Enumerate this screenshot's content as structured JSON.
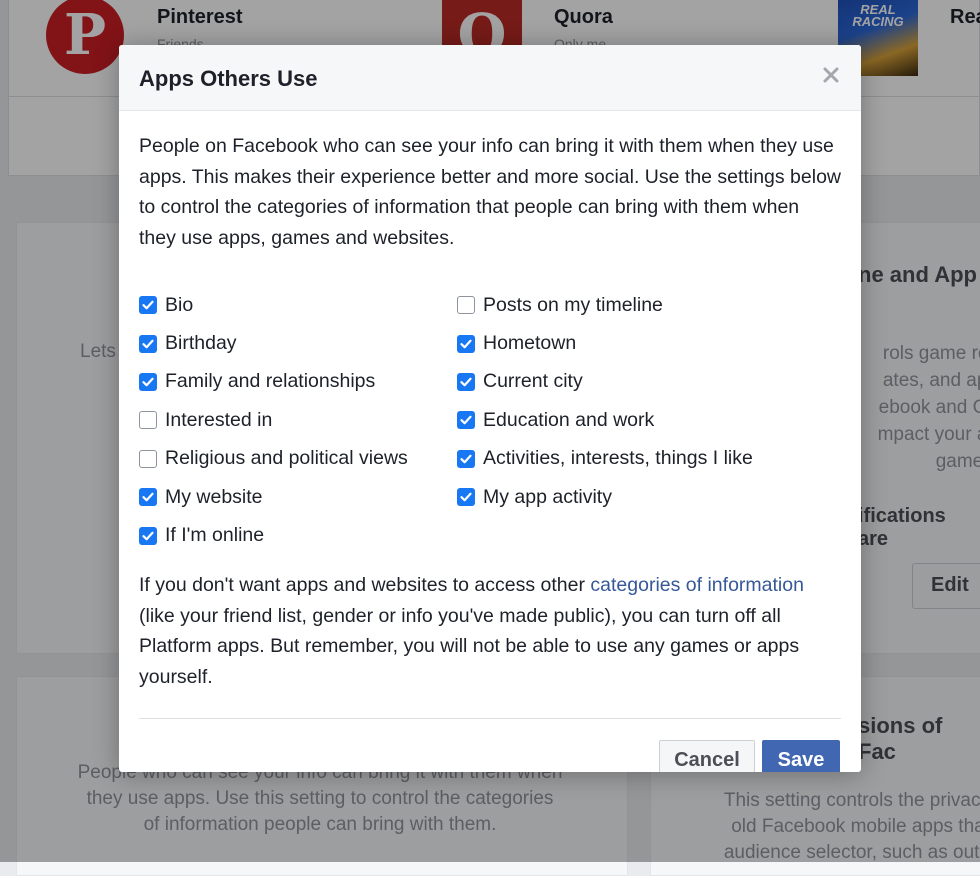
{
  "background": {
    "apps": [
      {
        "name": "Pinterest",
        "visibility": "Friends",
        "logo": "pinterest-logo"
      },
      {
        "name": "Quora",
        "visibility": "Only me",
        "logo": "quora-logo"
      },
      {
        "name": "Rea",
        "logo": "real-racing-logo"
      }
    ],
    "panels": {
      "left_mid_text": "Lets",
      "right_mid_title": "ne and App",
      "right_mid_lines": [
        "rols game rec",
        "ates, and app",
        "ebook and Ga",
        "mpact your ab",
        "games."
      ],
      "right_mid_notif": "ifications are",
      "edit_label": "Edit",
      "bottom_left_lines": [
        "People who can see your info can bring it with them when",
        "they use apps. Use this setting to control the categories",
        "of information people can bring with them."
      ],
      "bottom_right_title": "sions of Fac",
      "bottom_right_lines": [
        "This setting controls the privacy",
        "old Facebook mobile apps that",
        "audience selector, such as outd"
      ]
    }
  },
  "dialog": {
    "title": "Apps Others Use",
    "intro": "People on Facebook who can see your info can bring it with them when they use apps. This makes their experience better and more social. Use the settings below to control the categories of information that people can bring with them when they use apps, games and websites.",
    "left_options": [
      {
        "label": "Bio",
        "checked": true
      },
      {
        "label": "Birthday",
        "checked": true
      },
      {
        "label": "Family and relationships",
        "checked": true
      },
      {
        "label": "Interested in",
        "checked": false
      },
      {
        "label": "Religious and political views",
        "checked": false
      },
      {
        "label": "My website",
        "checked": true
      },
      {
        "label": "If I'm online",
        "checked": true
      }
    ],
    "right_options": [
      {
        "label": "Posts on my timeline",
        "checked": false
      },
      {
        "label": "Hometown",
        "checked": true
      },
      {
        "label": "Current city",
        "checked": true
      },
      {
        "label": "Education and work",
        "checked": true
      },
      {
        "label": "Activities, interests, things I like",
        "checked": true
      },
      {
        "label": "My app activity",
        "checked": true
      }
    ],
    "footer_before_link": "If you don't want apps and websites to access other ",
    "footer_link": "categories of information",
    "footer_after_link": " (like your friend list, gender or info you've made public), you can turn off all Platform apps. But remember, you will not be able to use any games or apps yourself.",
    "cancel_label": "Cancel",
    "save_label": "Save"
  },
  "colors": {
    "checkbox_on": "#1877f2",
    "save_button": "#4267b2",
    "link": "#365899"
  }
}
